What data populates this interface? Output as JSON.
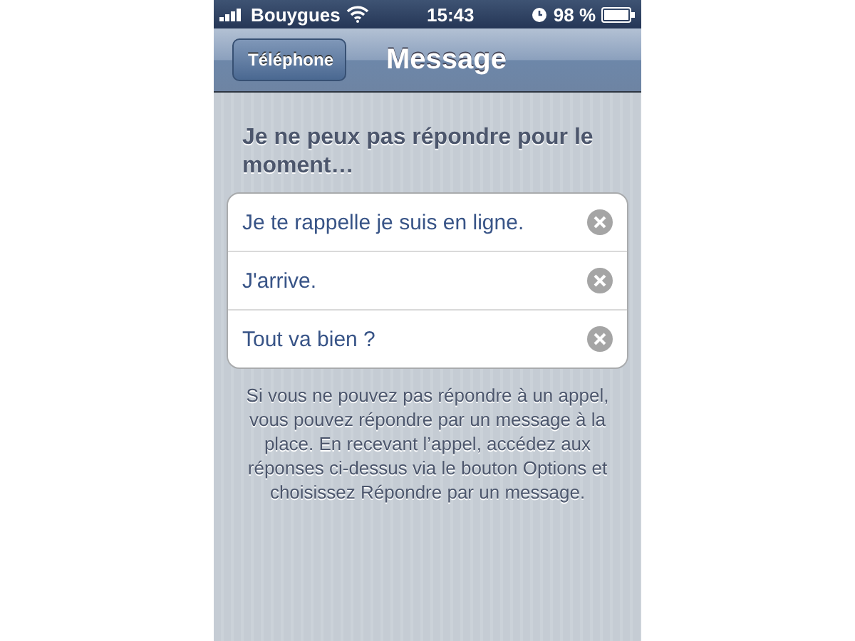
{
  "status_bar": {
    "carrier": "Bouygues",
    "time": "15:43",
    "battery": "98 %"
  },
  "nav_bar": {
    "back": "Téléphone",
    "title": "Message"
  },
  "header": "Je ne peux pas répondre pour le moment…",
  "replies": [
    {
      "text": "Je te rappelle je suis en ligne."
    },
    {
      "text": "J'arrive."
    },
    {
      "text": "Tout va bien ?"
    }
  ],
  "footer": "Si vous ne pouvez pas répondre à un appel, vous pouvez répondre par un message à la place. En recevant l’appel, accédez aux réponses ci-dessus via le bouton Options et choisissez Répondre par un message."
}
